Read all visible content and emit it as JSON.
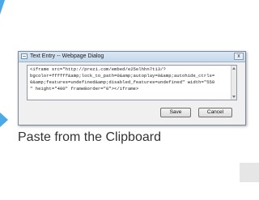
{
  "dialog": {
    "title": "Text Entry -- Webpage Dialog",
    "close_label": "x",
    "code_lines": [
      "<iframe src=\"http://prezi.com/embed/e25elhhn7t13/?",
      "bgcolor=ffffff&amp;lock_to_path=0&amp;autoplay=0&amp;autohide_ctrls=",
      "0&amp;features=undefined&amp;disabled_features=undefined\" width=\"550",
      "\" height=\"400\" frameBorder=\"0\"></iframe>"
    ],
    "save_label": "Save",
    "cancel_label": "Cancel"
  },
  "caption": "Paste from the Clipboard",
  "colors": {
    "accent": "#4aa9e6",
    "caption": "#333333"
  }
}
